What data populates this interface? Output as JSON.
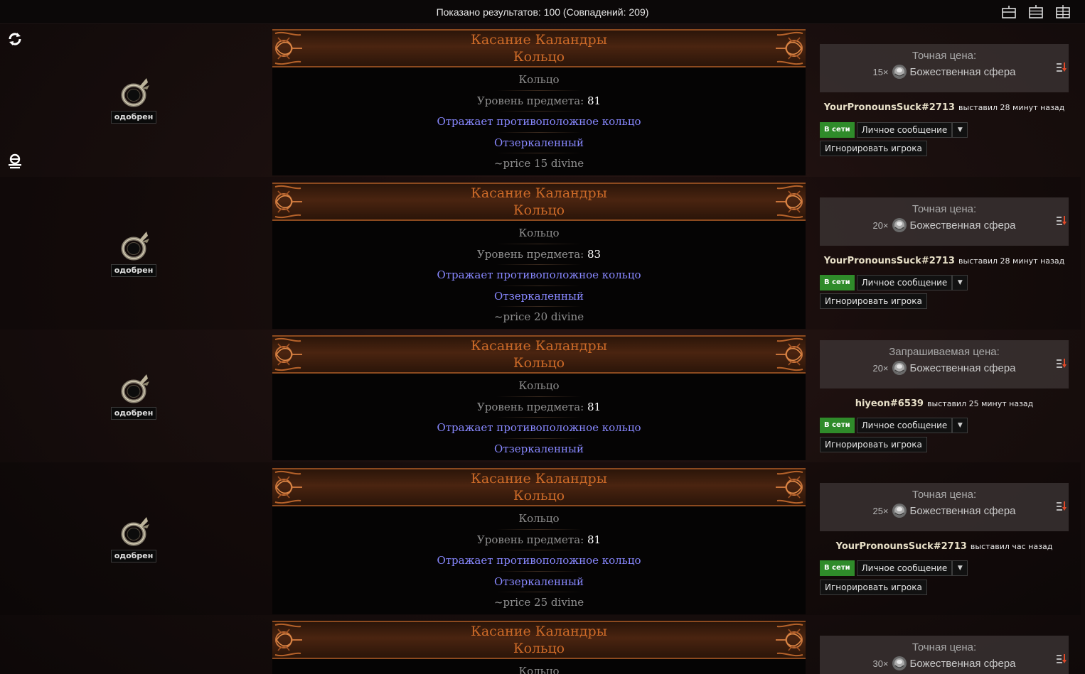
{
  "topbar": {
    "count": "Показано результатов: 100 (Совпадений: 209)"
  },
  "icons": {
    "refresh": "refresh-icon",
    "whisper": "search-whisper-icon",
    "layouts": [
      "layout-list-icon",
      "layout-compact-icon",
      "layout-grid-icon"
    ]
  },
  "listings": [
    {
      "name": "Касание Каландры",
      "base": "Кольцо",
      "type": "Кольцо",
      "level_label": "Уровень предмета:",
      "level": "81",
      "mods": [
        "Отражает противоположное кольцо",
        "Отзеркаленный"
      ],
      "note": "~price 15 divine",
      "verified": "одобрен",
      "price_label": "Точная цена:",
      "qty": "15×",
      "currency": "Божественная сфера",
      "account": "YourPronounsSuck#2713",
      "listed": "выставил 28 минут назад",
      "online": "В сети",
      "pm": "Личное сообщение",
      "ignore": "Игнорировать игрока"
    },
    {
      "name": "Касание Каландры",
      "base": "Кольцо",
      "type": "Кольцо",
      "level_label": "Уровень предмета:",
      "level": "83",
      "mods": [
        "Отражает противоположное кольцо",
        "Отзеркаленный"
      ],
      "note": "~price 20 divine",
      "verified": "одобрен",
      "price_label": "Точная цена:",
      "qty": "20×",
      "currency": "Божественная сфера",
      "account": "YourPronounsSuck#2713",
      "listed": "выставил 28 минут назад",
      "online": "В сети",
      "pm": "Личное сообщение",
      "ignore": "Игнорировать игрока"
    },
    {
      "name": "Касание Каландры",
      "base": "Кольцо",
      "type": "Кольцо",
      "level_label": "Уровень предмета:",
      "level": "81",
      "mods": [
        "Отражает противоположное кольцо",
        "Отзеркаленный"
      ],
      "note": "",
      "verified": "одобрен",
      "price_label": "Запрашиваемая цена:",
      "qty": "20×",
      "currency": "Божественная сфера",
      "account": "hiyeon#6539",
      "listed": "выставил 25 минут назад",
      "online": "В сети",
      "pm": "Личное сообщение",
      "ignore": "Игнорировать игрока"
    },
    {
      "name": "Касание Каландры",
      "base": "Кольцо",
      "type": "Кольцо",
      "level_label": "Уровень предмета:",
      "level": "81",
      "mods": [
        "Отражает противоположное кольцо",
        "Отзеркаленный"
      ],
      "note": "~price 25 divine",
      "verified": "одобрен",
      "price_label": "Точная цена:",
      "qty": "25×",
      "currency": "Божественная сфера",
      "account": "YourPronounsSuck#2713",
      "listed": "выставил час назад",
      "online": "В сети",
      "pm": "Личное сообщение",
      "ignore": "Игнорировать игрока"
    },
    {
      "name": "Касание Каландры",
      "base": "Кольцо",
      "type": "Кольцо",
      "price_label": "Точная цена:",
      "qty": "30×",
      "currency": "Божественная сфера"
    }
  ],
  "colors": {
    "unique_name": "#cc6a28",
    "mod_blue": "#8888ff",
    "online_green": "#2f8b2a"
  }
}
